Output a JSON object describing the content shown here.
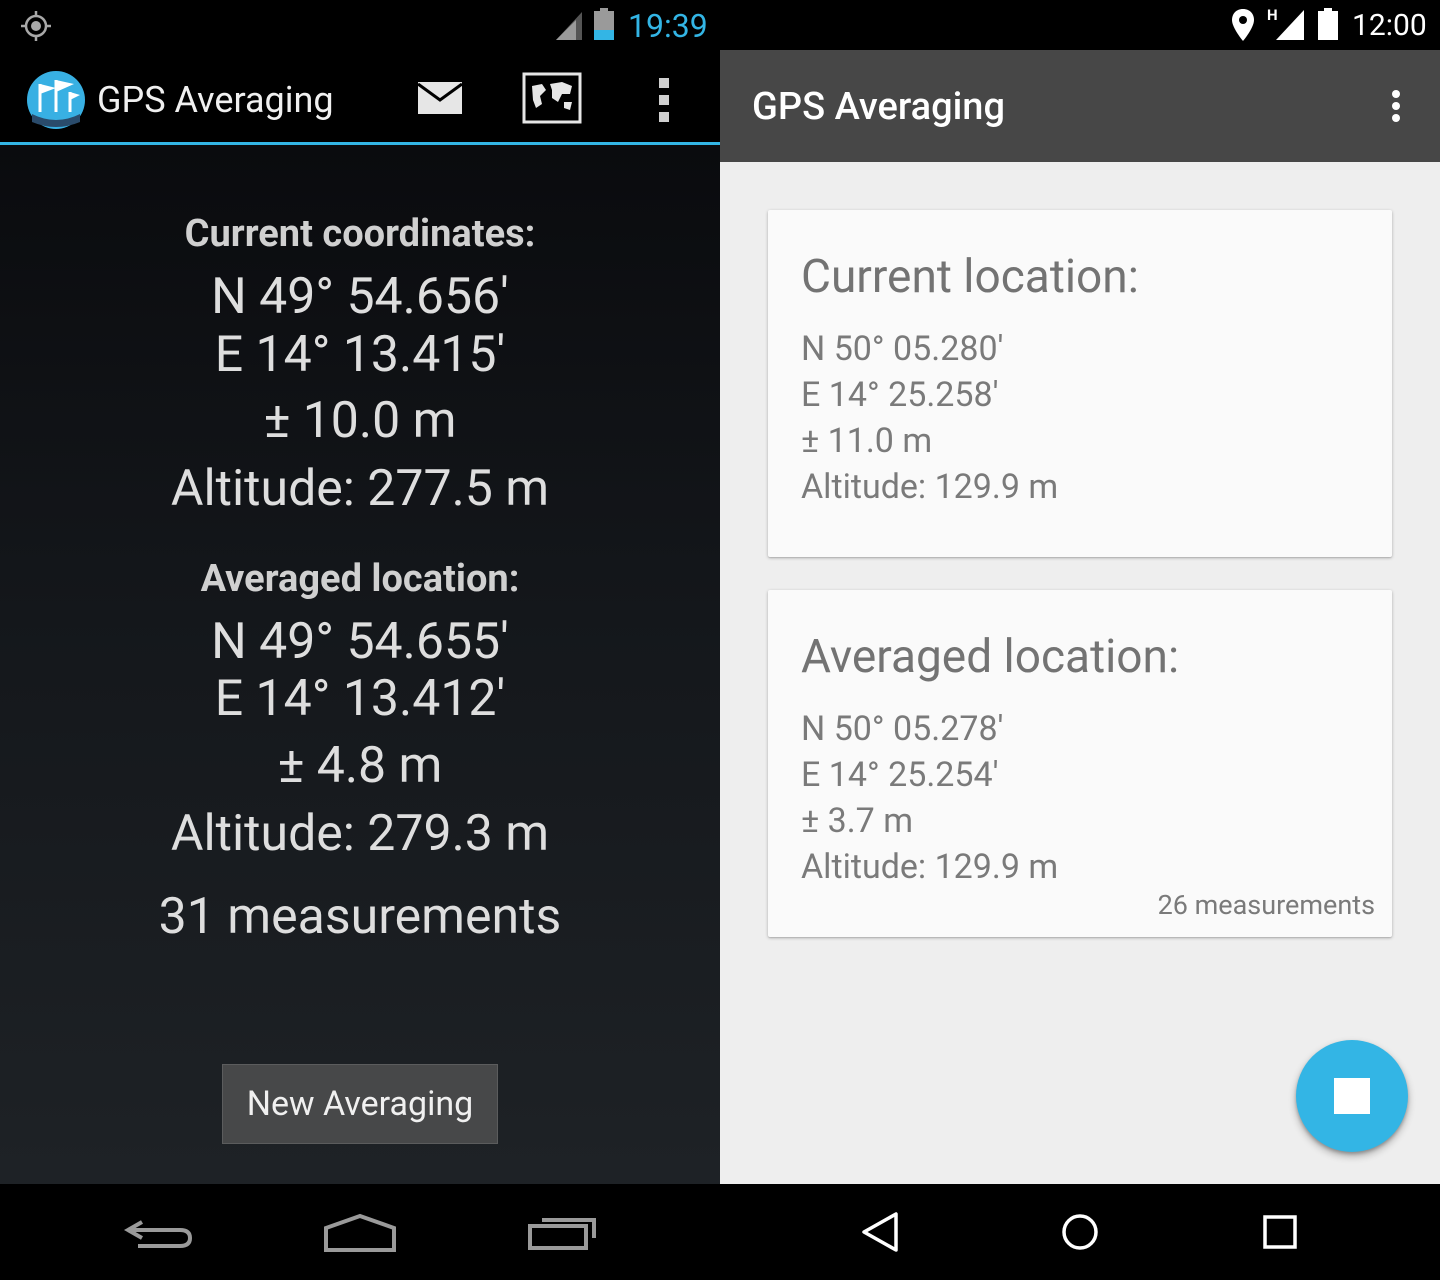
{
  "left": {
    "status_bar": {
      "time": "19:39",
      "accent_color": "#33b5e5"
    },
    "action_bar": {
      "title": "GPS Averaging",
      "icons": [
        "app-icon",
        "mail-icon",
        "map-icon",
        "overflow-menu-icon"
      ]
    },
    "current": {
      "heading": "Current coordinates:",
      "lat": "N 49° 54.656′",
      "lon": "E 14° 13.415′",
      "accuracy": "± 10.0 m",
      "altitude": "Altitude: 277.5 m"
    },
    "averaged": {
      "heading": "Averaged location:",
      "lat": "N 49° 54.655′",
      "lon": "E 14° 13.412′",
      "accuracy": "± 4.8 m",
      "altitude": "Altitude: 279.3 m"
    },
    "measurements": "31 measurements",
    "button_label": "New Averaging",
    "nav_icons": [
      "back-icon",
      "home-icon",
      "recents-icon"
    ]
  },
  "right": {
    "status_bar": {
      "time": "12:00",
      "network_letter": "H"
    },
    "toolbar": {
      "title": "GPS Averaging",
      "color": "#474747"
    },
    "current_card": {
      "title": "Current location:",
      "lat": "N 50° 05.280'",
      "lon": "E 14° 25.258'",
      "accuracy": "± 11.0 m",
      "altitude": "Altitude: 129.9 m"
    },
    "averaged_card": {
      "title": "Averaged location:",
      "lat": "N 50° 05.278'",
      "lon": "E 14° 25.254'",
      "accuracy": "± 3.7 m",
      "altitude": "Altitude: 129.9 m",
      "measurements": "26 measurements"
    },
    "fab": {
      "icon": "stop-icon",
      "color": "#33b5e5"
    },
    "nav_icons": [
      "back-icon",
      "home-icon",
      "recents-icon"
    ]
  }
}
